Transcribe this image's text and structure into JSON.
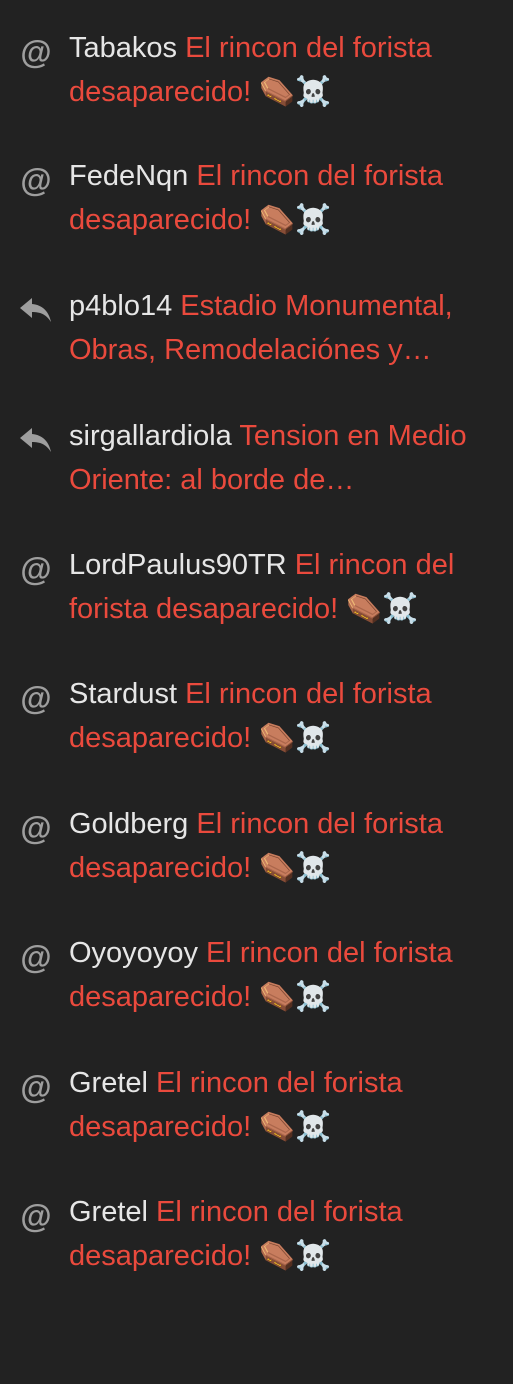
{
  "notifications": [
    {
      "type": "mention",
      "icon": "at-icon",
      "user": "Tabakos",
      "topic": "El rincon del forista desaparecido! ⚰️☠️"
    },
    {
      "type": "mention",
      "icon": "at-icon",
      "user": "FedeNqn",
      "topic": "El rincon del forista desaparecido! ⚰️☠️"
    },
    {
      "type": "reply",
      "icon": "reply-icon",
      "user": "p4blo14",
      "topic": "Estadio Monumental, Obras, Remodelaciónes y…"
    },
    {
      "type": "reply",
      "icon": "reply-icon",
      "user": "sirgallardiola",
      "topic": "Tension en Medio Oriente: al borde de…"
    },
    {
      "type": "mention",
      "icon": "at-icon",
      "user": "LordPaulus90TR",
      "topic": "El rincon del forista desaparecido! ⚰️☠️"
    },
    {
      "type": "mention",
      "icon": "at-icon",
      "user": "Stardust",
      "topic": "El rincon del forista desaparecido! ⚰️☠️"
    },
    {
      "type": "mention",
      "icon": "at-icon",
      "user": "Goldberg",
      "topic": "El rincon del forista desaparecido! ⚰️☠️"
    },
    {
      "type": "mention",
      "icon": "at-icon",
      "user": "Oyoyoyoy",
      "topic": "El rincon del forista desaparecido! ⚰️☠️"
    },
    {
      "type": "mention",
      "icon": "at-icon",
      "user": "Gretel",
      "topic": "El rincon del forista desaparecido! ⚰️☠️"
    },
    {
      "type": "mention",
      "icon": "at-icon",
      "user": "Gretel",
      "topic": "El rincon del forista desaparecido! ⚰️☠️"
    }
  ],
  "colors": {
    "background": "#222222",
    "username": "#e6e6e6",
    "topic": "#ea4a3d",
    "icon": "#9e9e9e"
  }
}
